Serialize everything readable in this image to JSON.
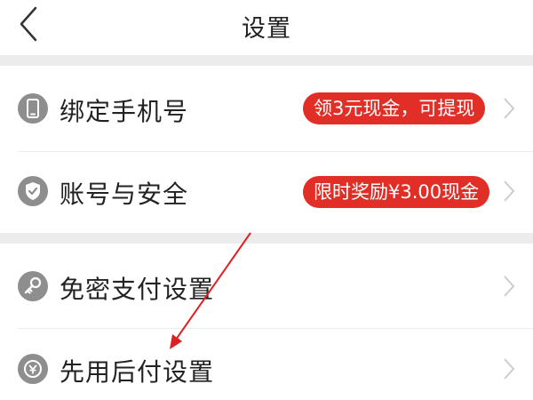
{
  "header": {
    "title": "设置"
  },
  "rows": [
    {
      "label": "绑定手机号",
      "badge": "领3元现金，可提现",
      "icon": "phone-icon"
    },
    {
      "label": "账号与安全",
      "badge": "限时奖励¥3.00现金",
      "icon": "shield-check-icon"
    },
    {
      "label": "免密支付设置",
      "icon": "key-icon"
    },
    {
      "label": "先用后付设置",
      "icon": "pay-later-icon"
    }
  ],
  "colors": {
    "accent": "#e12f28",
    "icon_gray": "#8e8e8e",
    "annotation_arrow": "#e02020",
    "section_divider": "#ececec"
  },
  "annotation": {
    "type": "arrow",
    "points_to": "先用后付设置"
  }
}
